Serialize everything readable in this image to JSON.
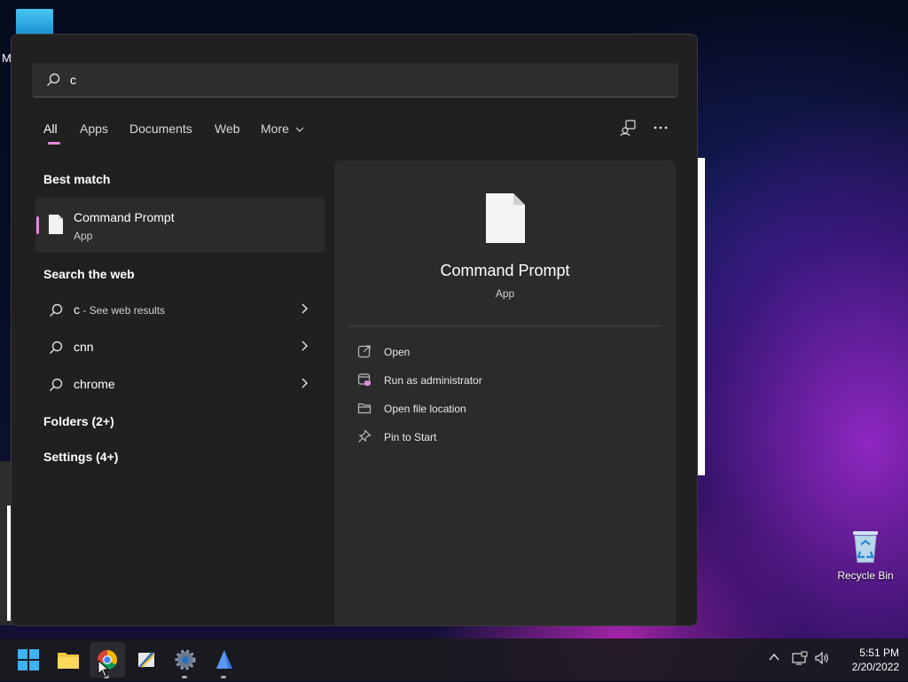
{
  "desktop": {
    "partial_label": "M",
    "recycle_bin_label": "Recycle Bin"
  },
  "search": {
    "query": "c"
  },
  "tabs": [
    {
      "label": "All",
      "active": true
    },
    {
      "label": "Apps"
    },
    {
      "label": "Documents"
    },
    {
      "label": "Web"
    },
    {
      "label": "More"
    }
  ],
  "best_match": {
    "heading": "Best match",
    "title": "Command Prompt",
    "subtitle": "App"
  },
  "web": {
    "heading": "Search the web",
    "items": [
      {
        "label": "c",
        "suffix": " - See web results"
      },
      {
        "label": "cnn"
      },
      {
        "label": "chrome"
      }
    ]
  },
  "folders_heading": "Folders (2+)",
  "settings_heading": "Settings (4+)",
  "details": {
    "title": "Command Prompt",
    "subtitle": "App",
    "actions": [
      {
        "label": "Open",
        "icon": "open-external-icon"
      },
      {
        "label": "Run as administrator",
        "icon": "admin-shield-icon"
      },
      {
        "label": "Open file location",
        "icon": "folder-icon"
      },
      {
        "label": "Pin to Start",
        "icon": "pin-icon"
      }
    ]
  },
  "taskbar": {
    "apps": [
      "start-button",
      "file-explorer",
      "chrome",
      "python-idle",
      "settings",
      "azure-data-studio"
    ],
    "time": "5:51 PM",
    "date": "2/20/2022"
  },
  "colors": {
    "accent": "#e38ad8",
    "panel": "#202020",
    "pane": "#2b2b2b"
  }
}
